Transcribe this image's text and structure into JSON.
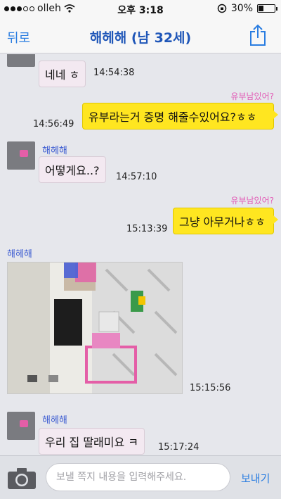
{
  "status_bar": {
    "carrier": "olleh",
    "time": "오후 3:18",
    "battery_percent": "30%",
    "battery_level": 0.3
  },
  "nav": {
    "back_label": "뒤로",
    "title": "해헤해 (남 32세)",
    "share_icon": "share-icon"
  },
  "messages": [
    {
      "from": "them",
      "text": "네네 ㅎ",
      "time": "14:54:38"
    },
    {
      "from": "me",
      "sub": "유부남있어?",
      "text": "유부라는거 증명 해줄수있어요?ㅎㅎ",
      "time": "14:56:49"
    },
    {
      "from": "them",
      "sender": "해헤해",
      "text": "어떻게요..?",
      "time": "14:57:10"
    },
    {
      "from": "me",
      "sub": "유부남있어?",
      "text": "그냥 아무거나ㅎㅎ",
      "time": "15:13:39"
    },
    {
      "from": "them",
      "sender": "해헤해",
      "type": "photo",
      "time": "15:15:56"
    },
    {
      "from": "them",
      "sender": "해헤해",
      "text": "우리 집 딸래미요 ㅋ",
      "time": "15:17:24"
    }
  ],
  "input": {
    "placeholder": "보낼 쪽지 내용을 입력해주세요.",
    "value": "",
    "send_label": "보내기"
  },
  "colors": {
    "accent": "#2a7de1",
    "title": "#1f56b8",
    "bubble_out": "#ffe620",
    "bubble_in": "#f3e9f1",
    "sub_text": "#e25cb6"
  }
}
